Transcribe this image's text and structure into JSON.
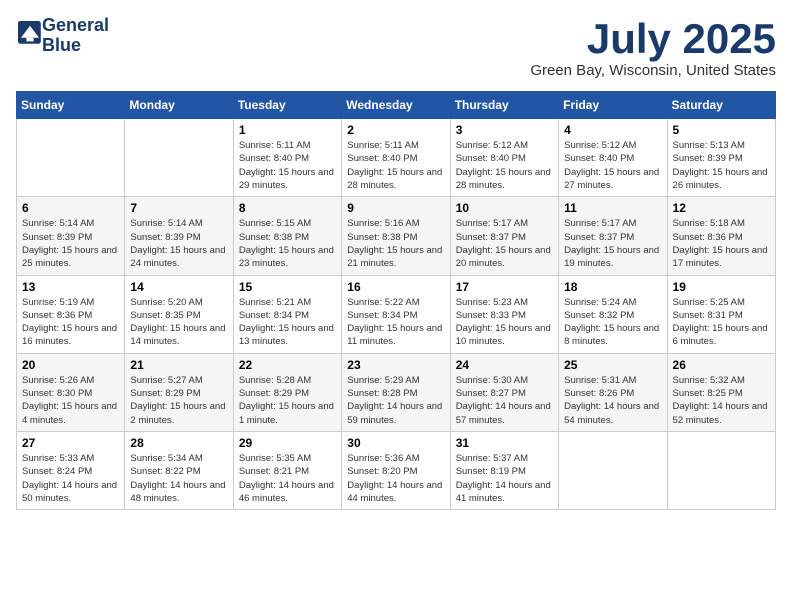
{
  "logo": {
    "line1": "General",
    "line2": "Blue"
  },
  "title": "July 2025",
  "location": "Green Bay, Wisconsin, United States",
  "days_of_week": [
    "Sunday",
    "Monday",
    "Tuesday",
    "Wednesday",
    "Thursday",
    "Friday",
    "Saturday"
  ],
  "weeks": [
    [
      {
        "day": "",
        "info": ""
      },
      {
        "day": "",
        "info": ""
      },
      {
        "day": "1",
        "info": "Sunrise: 5:11 AM\nSunset: 8:40 PM\nDaylight: 15 hours\nand 29 minutes."
      },
      {
        "day": "2",
        "info": "Sunrise: 5:11 AM\nSunset: 8:40 PM\nDaylight: 15 hours\nand 28 minutes."
      },
      {
        "day": "3",
        "info": "Sunrise: 5:12 AM\nSunset: 8:40 PM\nDaylight: 15 hours\nand 28 minutes."
      },
      {
        "day": "4",
        "info": "Sunrise: 5:12 AM\nSunset: 8:40 PM\nDaylight: 15 hours\nand 27 minutes."
      },
      {
        "day": "5",
        "info": "Sunrise: 5:13 AM\nSunset: 8:39 PM\nDaylight: 15 hours\nand 26 minutes."
      }
    ],
    [
      {
        "day": "6",
        "info": "Sunrise: 5:14 AM\nSunset: 8:39 PM\nDaylight: 15 hours\nand 25 minutes."
      },
      {
        "day": "7",
        "info": "Sunrise: 5:14 AM\nSunset: 8:39 PM\nDaylight: 15 hours\nand 24 minutes."
      },
      {
        "day": "8",
        "info": "Sunrise: 5:15 AM\nSunset: 8:38 PM\nDaylight: 15 hours\nand 23 minutes."
      },
      {
        "day": "9",
        "info": "Sunrise: 5:16 AM\nSunset: 8:38 PM\nDaylight: 15 hours\nand 21 minutes."
      },
      {
        "day": "10",
        "info": "Sunrise: 5:17 AM\nSunset: 8:37 PM\nDaylight: 15 hours\nand 20 minutes."
      },
      {
        "day": "11",
        "info": "Sunrise: 5:17 AM\nSunset: 8:37 PM\nDaylight: 15 hours\nand 19 minutes."
      },
      {
        "day": "12",
        "info": "Sunrise: 5:18 AM\nSunset: 8:36 PM\nDaylight: 15 hours\nand 17 minutes."
      }
    ],
    [
      {
        "day": "13",
        "info": "Sunrise: 5:19 AM\nSunset: 8:36 PM\nDaylight: 15 hours\nand 16 minutes."
      },
      {
        "day": "14",
        "info": "Sunrise: 5:20 AM\nSunset: 8:35 PM\nDaylight: 15 hours\nand 14 minutes."
      },
      {
        "day": "15",
        "info": "Sunrise: 5:21 AM\nSunset: 8:34 PM\nDaylight: 15 hours\nand 13 minutes."
      },
      {
        "day": "16",
        "info": "Sunrise: 5:22 AM\nSunset: 8:34 PM\nDaylight: 15 hours\nand 11 minutes."
      },
      {
        "day": "17",
        "info": "Sunrise: 5:23 AM\nSunset: 8:33 PM\nDaylight: 15 hours\nand 10 minutes."
      },
      {
        "day": "18",
        "info": "Sunrise: 5:24 AM\nSunset: 8:32 PM\nDaylight: 15 hours\nand 8 minutes."
      },
      {
        "day": "19",
        "info": "Sunrise: 5:25 AM\nSunset: 8:31 PM\nDaylight: 15 hours\nand 6 minutes."
      }
    ],
    [
      {
        "day": "20",
        "info": "Sunrise: 5:26 AM\nSunset: 8:30 PM\nDaylight: 15 hours\nand 4 minutes."
      },
      {
        "day": "21",
        "info": "Sunrise: 5:27 AM\nSunset: 8:29 PM\nDaylight: 15 hours\nand 2 minutes."
      },
      {
        "day": "22",
        "info": "Sunrise: 5:28 AM\nSunset: 8:29 PM\nDaylight: 15 hours\nand 1 minute."
      },
      {
        "day": "23",
        "info": "Sunrise: 5:29 AM\nSunset: 8:28 PM\nDaylight: 14 hours\nand 59 minutes."
      },
      {
        "day": "24",
        "info": "Sunrise: 5:30 AM\nSunset: 8:27 PM\nDaylight: 14 hours\nand 57 minutes."
      },
      {
        "day": "25",
        "info": "Sunrise: 5:31 AM\nSunset: 8:26 PM\nDaylight: 14 hours\nand 54 minutes."
      },
      {
        "day": "26",
        "info": "Sunrise: 5:32 AM\nSunset: 8:25 PM\nDaylight: 14 hours\nand 52 minutes."
      }
    ],
    [
      {
        "day": "27",
        "info": "Sunrise: 5:33 AM\nSunset: 8:24 PM\nDaylight: 14 hours\nand 50 minutes."
      },
      {
        "day": "28",
        "info": "Sunrise: 5:34 AM\nSunset: 8:22 PM\nDaylight: 14 hours\nand 48 minutes."
      },
      {
        "day": "29",
        "info": "Sunrise: 5:35 AM\nSunset: 8:21 PM\nDaylight: 14 hours\nand 46 minutes."
      },
      {
        "day": "30",
        "info": "Sunrise: 5:36 AM\nSunset: 8:20 PM\nDaylight: 14 hours\nand 44 minutes."
      },
      {
        "day": "31",
        "info": "Sunrise: 5:37 AM\nSunset: 8:19 PM\nDaylight: 14 hours\nand 41 minutes."
      },
      {
        "day": "",
        "info": ""
      },
      {
        "day": "",
        "info": ""
      }
    ]
  ]
}
